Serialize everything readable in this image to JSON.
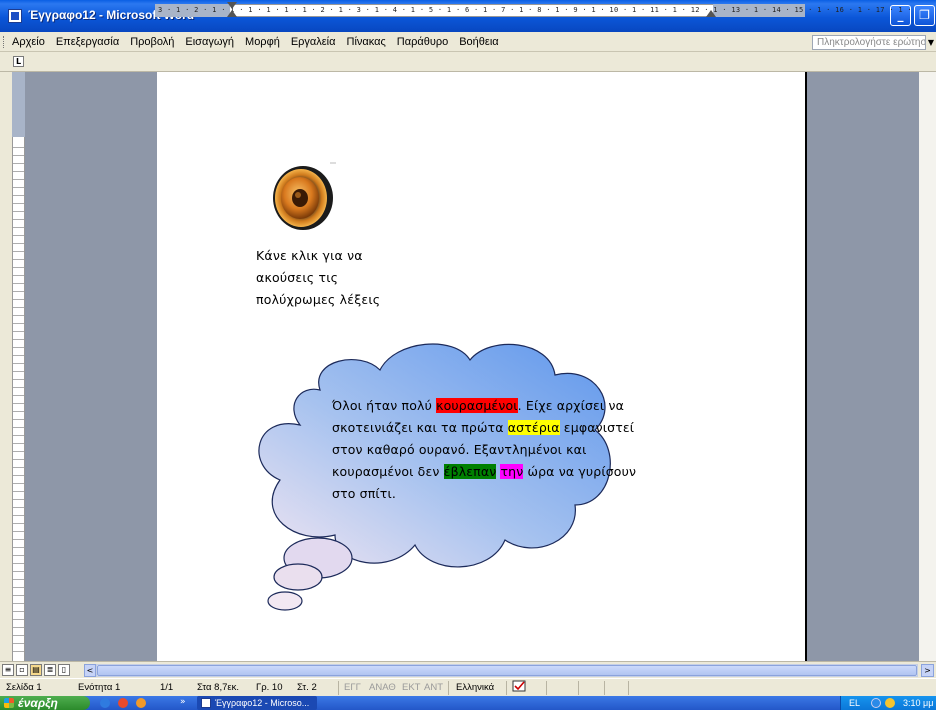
{
  "window": {
    "title": "Έγγραφο12 - Microsoft Word",
    "min_glyph": "_",
    "max_glyph": "❐",
    "close_glyph": "✕"
  },
  "menu": {
    "items": [
      "Αρχείο",
      "Επεξεργασία",
      "Προβολή",
      "Εισαγωγή",
      "Μορφή",
      "Εργαλεία",
      "Πίνακας",
      "Παράθυρο",
      "Βοήθεια"
    ],
    "help_placeholder": "Πληκτρολογήστε ερώτηση",
    "help_arrow": "▼"
  },
  "ruler": {
    "tab_glyph": "L",
    "h_text": "3 · 1 · 2 · 1 · 1 · 1 · 1 · 1 · 1 · 2 · 1 · 3 · 1 · 4 · 1 · 5 · 1 · 6 · 1 · 7 · 1 · 8 · 1 · 9 · 1 · 10 · 1 · 11 · 1 · 12 · 1 · 13 · 1 · 14 · 15 · 1 · 16 · 1 · 17 · 1 ·"
  },
  "document": {
    "speaker_caption": [
      "Κάνε κλικ για να",
      "ακούσεις τις",
      "πολύχρωμες λέξεις"
    ],
    "cloud": {
      "p1": "Όλοι ήταν πολύ ",
      "w_red": "κουρασμένοι",
      "p2": ". Είχε αρχίσει να σκοτεινιάζει και τα πρώτα ",
      "w_yellow": "αστέρια",
      "p3": " εμφανιστεί στον καθαρό ουρανό. Εξαντλημένοι και κουρασμένοι δεν ",
      "w_green": "έβλεπαν",
      "w_magenta": "την",
      "p4": " ώρα να γυρίσουν στο σπίτι."
    },
    "highlight_colors": {
      "red": "#ff0000",
      "yellow": "#ffff00",
      "green": "#008000",
      "magenta": "#ff00ff"
    }
  },
  "scroll": {
    "left_glyph": "<",
    "right_glyph": ">"
  },
  "status": {
    "page": "Σελίδα 1",
    "section": "Ενότητα 1",
    "pages": "1/1",
    "at": "Στα 8,7εκ.",
    "line": "Γρ. 10",
    "col": "Στ. 2",
    "rec": "ΕΓΓ",
    "trk": "ΑΝΑΘ",
    "ext": "ΕΚΤ",
    "ovr": "ΑΝΤ",
    "language": "Ελληνικά"
  },
  "taskbar": {
    "start_label": "έναρξη",
    "chevron": "»",
    "task_word": "Έγγραφο12 - Microso...",
    "lang": "EL",
    "clock": "3:10 μμ"
  }
}
